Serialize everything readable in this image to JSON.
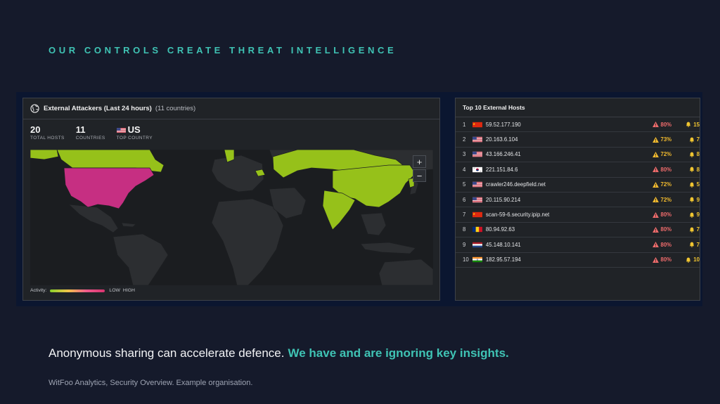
{
  "heading": "OUR CONTROLS CREATE THREAT INTELLIGENCE",
  "map_panel": {
    "title": "External Attackers (Last 24 hours)",
    "title_suffix": "(11 countries)",
    "stats": [
      {
        "value": "20",
        "label": "TOTAL HOSTS"
      },
      {
        "value": "11",
        "label": "COUNTRIES"
      },
      {
        "value": "US",
        "label": "TOP COUNTRY"
      }
    ],
    "zoom_in": "+",
    "zoom_out": "−",
    "legend": {
      "label": "Activity:",
      "low": "LOW",
      "high": "HIGH"
    },
    "colors": {
      "us": "#c62f82",
      "highlight": "#96c11a",
      "land": "#2c2e31"
    }
  },
  "hosts_panel": {
    "title": "Top 10 External Hosts",
    "rows": [
      {
        "rank": "1",
        "flag": "cn",
        "host": "59.52.177.190",
        "risk": "80%",
        "level": "red",
        "alerts": "15"
      },
      {
        "rank": "2",
        "flag": "us",
        "host": "20.163.6.104",
        "risk": "73%",
        "level": "amber",
        "alerts": "7"
      },
      {
        "rank": "3",
        "flag": "us",
        "host": "43.166.246.41",
        "risk": "72%",
        "level": "amber",
        "alerts": "8"
      },
      {
        "rank": "4",
        "flag": "kr",
        "host": "221.151.84.6",
        "risk": "80%",
        "level": "red",
        "alerts": "8"
      },
      {
        "rank": "5",
        "flag": "us",
        "host": "crawler246.deepfield.net",
        "risk": "72%",
        "level": "amber",
        "alerts": "5"
      },
      {
        "rank": "6",
        "flag": "us",
        "host": "20.115.90.214",
        "risk": "72%",
        "level": "amber",
        "alerts": "9"
      },
      {
        "rank": "7",
        "flag": "cn",
        "host": "scan-59-6.security.ipip.net",
        "risk": "80%",
        "level": "red",
        "alerts": "9"
      },
      {
        "rank": "8",
        "flag": "ro",
        "host": "80.94.92.63",
        "risk": "80%",
        "level": "red",
        "alerts": "7"
      },
      {
        "rank": "9",
        "flag": "nl",
        "host": "45.148.10.141",
        "risk": "80%",
        "level": "red",
        "alerts": "7"
      },
      {
        "rank": "10",
        "flag": "in",
        "host": "182.95.57.194",
        "risk": "80%",
        "level": "red",
        "alerts": "10"
      }
    ]
  },
  "tagline": {
    "text": "Anonymous sharing can accelerate defence.",
    "accent": "We have and are ignoring key insights."
  },
  "caption": "WitFoo Analytics, Security Overview. Example organisation."
}
